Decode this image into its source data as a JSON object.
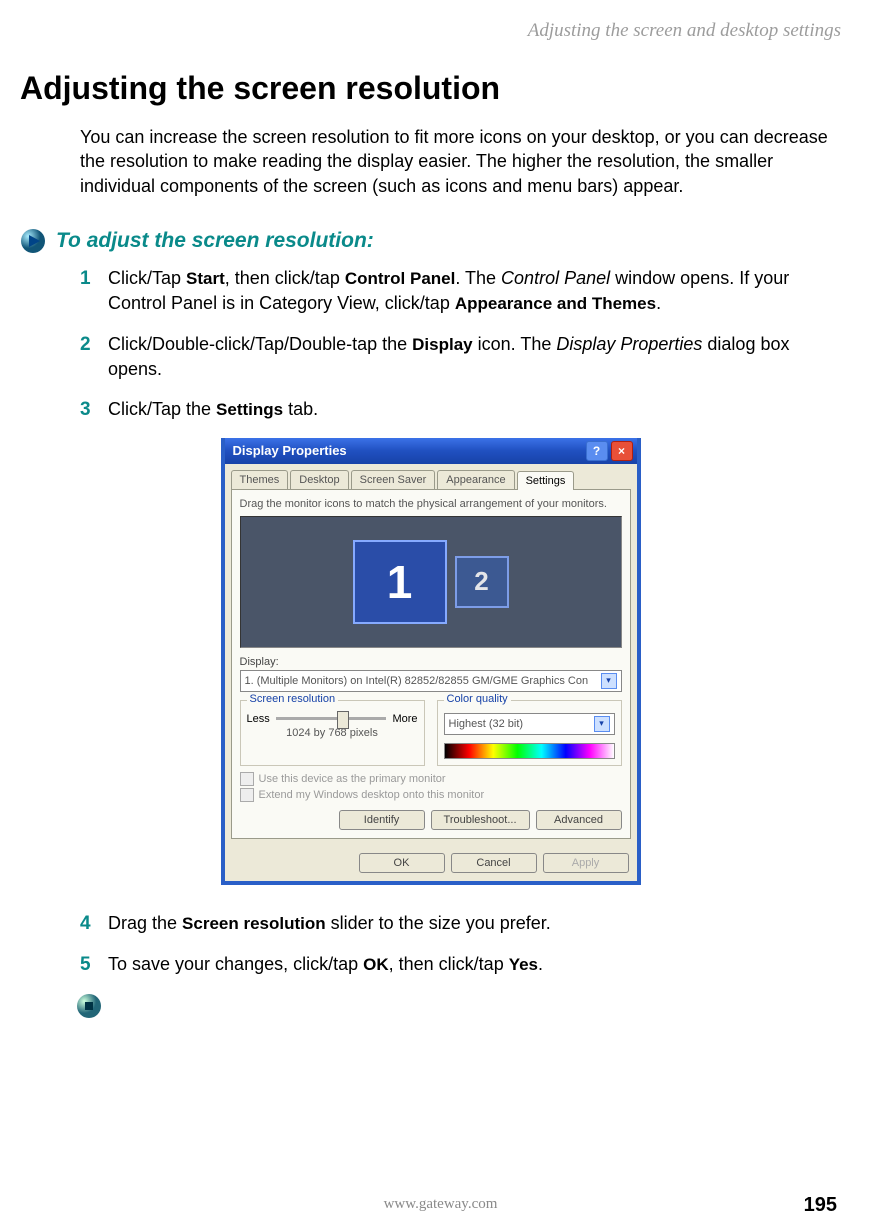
{
  "header": {
    "running": "Adjusting the screen and desktop settings"
  },
  "title": "Adjusting the screen resolution",
  "intro": "You can increase the screen resolution to fit more icons on your desktop, or you can decrease the resolution to make reading the display easier. The higher the resolution, the smaller individual components of the screen (such as icons and menu bars) appear.",
  "task_title": "To adjust the screen resolution:",
  "steps": {
    "s1": {
      "t1": "Click/Tap ",
      "b1": "Start",
      "t2": ", then click/tap ",
      "b2": "Control Panel",
      "t3": ". The ",
      "i1": "Control Panel",
      "t4": " window opens. If your Control Panel is in Category View, click/tap ",
      "b3": "Appearance and Themes",
      "t5": "."
    },
    "s2": {
      "t1": "Click/Double-click/Tap/Double-tap the ",
      "b1": "Display",
      "t2": " icon. The ",
      "i1": "Display Properties",
      "t3": " dialog box opens."
    },
    "s3": {
      "t1": "Click/Tap the ",
      "b1": "Settings",
      "t2": " tab."
    },
    "s4": {
      "t1": "Drag the ",
      "b1": "Screen resolution",
      "t2": " slider to the size you prefer."
    },
    "s5": {
      "t1": "To save your changes, click/tap ",
      "b1": "OK",
      "t2": ", then click/tap ",
      "b2": "Yes",
      "t3": "."
    }
  },
  "dialog": {
    "title": "Display Properties",
    "tabs": [
      "Themes",
      "Desktop",
      "Screen Saver",
      "Appearance",
      "Settings"
    ],
    "active_tab": "Settings",
    "hint": "Drag the monitor icons to match the physical arrangement of your monitors.",
    "monitors": {
      "primary": "1",
      "secondary": "2"
    },
    "display_label": "Display:",
    "display_value": "1. (Multiple Monitors) on Intel(R) 82852/82855 GM/GME Graphics Con",
    "res_group": "Screen resolution",
    "res_less": "Less",
    "res_more": "More",
    "res_value": "1024 by 768 pixels",
    "color_group": "Color quality",
    "color_value": "Highest (32 bit)",
    "cb1": "Use this device as the primary monitor",
    "cb2": "Extend my Windows desktop onto this monitor",
    "btn_identify": "Identify",
    "btn_trouble": "Troubleshoot...",
    "btn_adv": "Advanced",
    "btn_ok": "OK",
    "btn_cancel": "Cancel",
    "btn_apply": "Apply"
  },
  "footer": {
    "url": "www.gateway.com",
    "page": "195"
  }
}
